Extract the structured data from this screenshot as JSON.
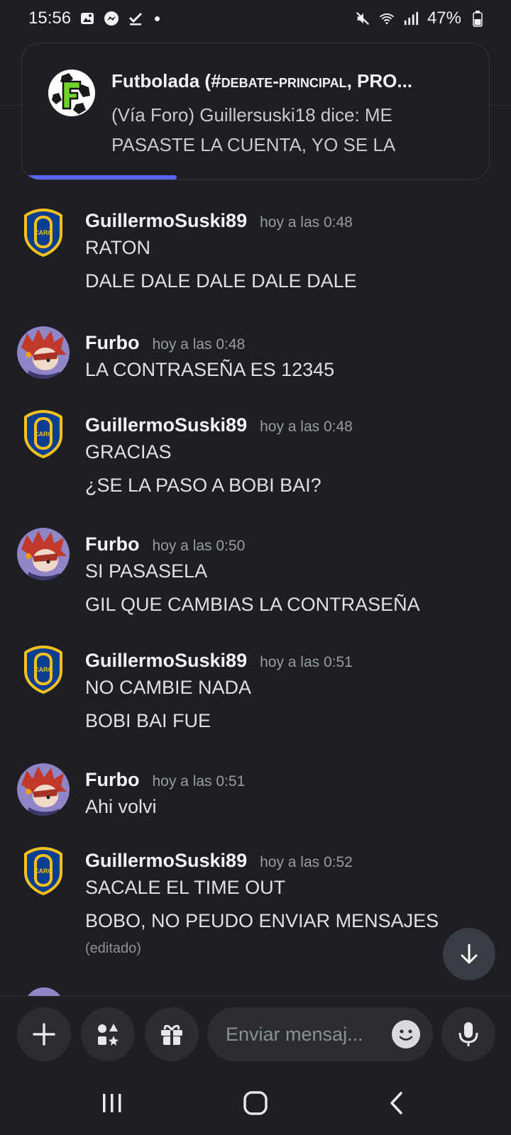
{
  "status_bar": {
    "time": "15:56",
    "battery": "47%",
    "left_icons": [
      "gallery-icon",
      "messenger-icon",
      "checkmark-icon",
      "dot-icon"
    ],
    "right_icons": [
      "mute-icon",
      "wifi-icon",
      "signal-icon",
      "battery-icon"
    ]
  },
  "notification": {
    "title_prefix": "Futbolada (#",
    "title_channel": "debate-principal",
    "title_suffix": ", PRO...",
    "body": "(Vía Foro) Guillersuski18 dice: ME PASASTE LA CUENTA, YO SE LA",
    "progress": 0.33
  },
  "messages": [
    {
      "author": "GuillermoSuski89",
      "time": "hoy a las 0:48",
      "lines": [
        "RATON",
        "DALE DALE DALE DALE DALE"
      ]
    },
    {
      "author": "Furbo",
      "time": "hoy a las 0:48",
      "lines": [
        "LA CONTRASEÑA ES 12345"
      ]
    },
    {
      "author": "GuillermoSuski89",
      "time": "hoy a las 0:48",
      "lines": [
        "GRACIAS",
        "¿SE LA PASO  A BOBI BAI?"
      ]
    },
    {
      "author": "Furbo",
      "time": "hoy a las 0:50",
      "lines": [
        "SI PASASELA",
        "GIL QUE CAMBIAS LA CONTRASEÑA"
      ]
    },
    {
      "author": "GuillermoSuski89",
      "time": "hoy a las 0:51",
      "lines": [
        "NO CAMBIE NADA",
        "BOBI BAI FUE"
      ]
    },
    {
      "author": "Furbo",
      "time": "hoy a las 0:51",
      "lines": [
        "Ahi volvi"
      ]
    },
    {
      "author": "GuillermoSuski89",
      "time": "hoy a las 0:52",
      "lines": [
        "SACALE EL TIME OUT",
        "BOBO, NO PEUDO ENVIAR MENSAJES"
      ],
      "edited": "(editado)"
    }
  ],
  "composer": {
    "placeholder": "Enviar mensaj..."
  }
}
